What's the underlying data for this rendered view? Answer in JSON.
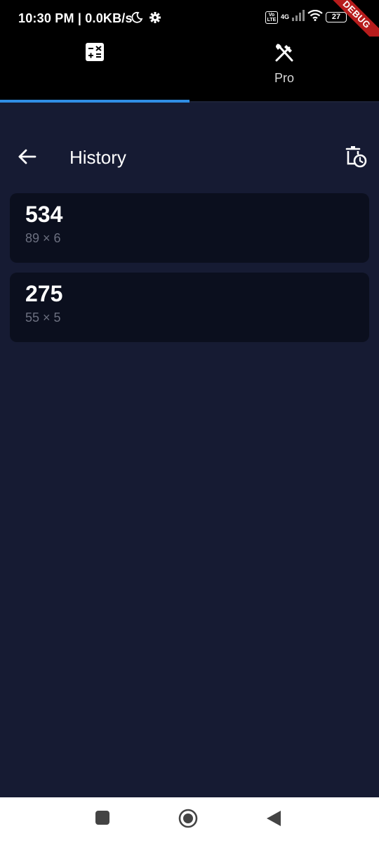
{
  "status_bar": {
    "time_speed": "10:30 PM | 0.0KB/s",
    "volte_label": "Vo LTE",
    "network_type": "4G",
    "battery_level": "27",
    "debug_label": "DEBUG"
  },
  "tabs": [
    {
      "icon": "calculator-icon",
      "label": ""
    },
    {
      "icon": "fork-knife-icon",
      "label": "Pro"
    }
  ],
  "app_bar": {
    "title": "History"
  },
  "history": [
    {
      "result": "534",
      "expression": "89 × 6"
    },
    {
      "result": "275",
      "expression": "55 × 5"
    }
  ],
  "colors": {
    "background": "#161b33",
    "card": "#0b0f1e",
    "tab_indicator": "#2f8de4",
    "debug_banner": "#b71c1c"
  }
}
